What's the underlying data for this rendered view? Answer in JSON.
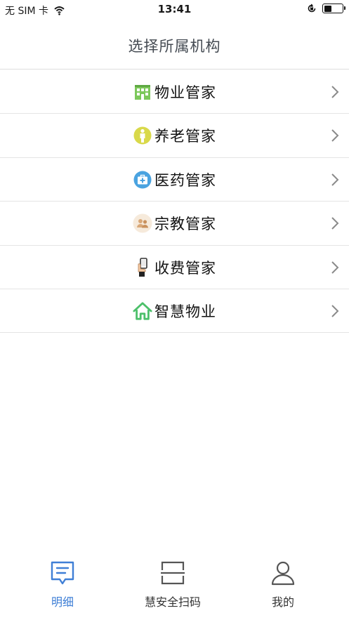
{
  "status_bar": {
    "carrier": "无 SIM 卡",
    "time": "13:41",
    "battery_level": 0.45
  },
  "nav": {
    "title": "选择所属机构"
  },
  "organizations": [
    {
      "label": "物业管家",
      "icon": "building-icon"
    },
    {
      "label": "养老管家",
      "icon": "elderly-person-icon"
    },
    {
      "label": "医药管家",
      "icon": "medical-kit-icon"
    },
    {
      "label": "宗教管家",
      "icon": "people-group-icon"
    },
    {
      "label": "收费管家",
      "icon": "hand-phone-icon"
    },
    {
      "label": "智慧物业",
      "icon": "house-icon"
    }
  ],
  "tabs": [
    {
      "label": "明细",
      "icon": "message-list-icon",
      "active": true
    },
    {
      "label": "慧安全扫码",
      "icon": "scan-icon",
      "active": false
    },
    {
      "label": "我的",
      "icon": "user-icon",
      "active": false
    }
  ],
  "colors": {
    "accent": "#3f7fd6",
    "building_green": "#7cc85a",
    "elderly_yellow": "#d9d94a",
    "medical_blue": "#4aa3e0",
    "religion_tan": "#d9a878",
    "house_green": "#4cc06a"
  }
}
